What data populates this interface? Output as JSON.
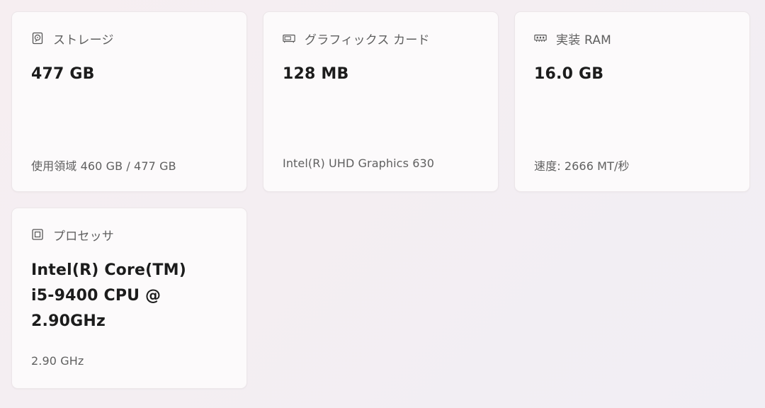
{
  "cards": {
    "storage": {
      "icon": "hard-drive-icon",
      "label": "ストレージ",
      "value": "477 GB",
      "detail": "使用領域 460 GB / 477 GB"
    },
    "gpu": {
      "icon": "graphics-card-icon",
      "label": "グラフィックス カード",
      "value": "128 MB",
      "detail": "Intel(R) UHD Graphics 630"
    },
    "ram": {
      "icon": "memory-icon",
      "label": "実装 RAM",
      "value": "16.0 GB",
      "detail": "速度: 2666 MT/秒"
    },
    "cpu": {
      "icon": "processor-icon",
      "label": "プロセッサ",
      "value": "Intel(R) Core(TM) i5-9400 CPU @ 2.90GHz",
      "detail": "2.90 GHz"
    }
  },
  "colors": {
    "background": "#f5eef2",
    "card": "#fcfafb",
    "text_primary": "#1c1c1c",
    "text_secondary": "#606060"
  }
}
